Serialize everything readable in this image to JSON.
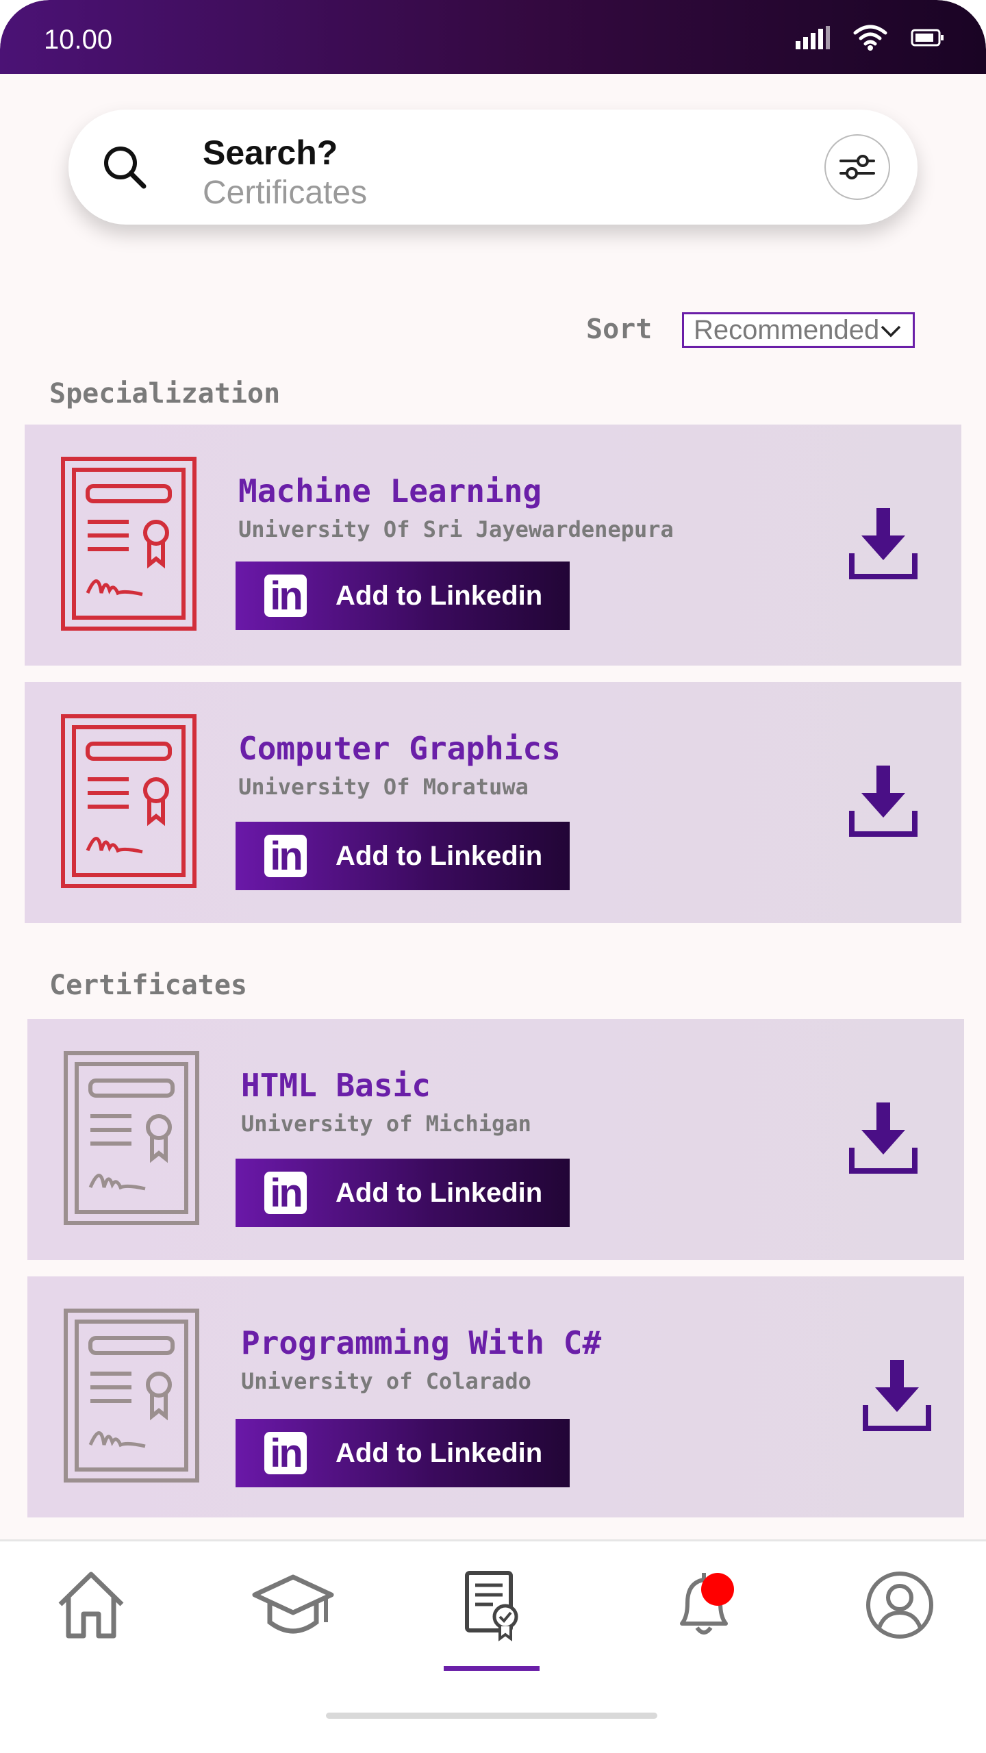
{
  "status_bar": {
    "time": "10.00"
  },
  "search": {
    "title": "Search?",
    "subtitle": "Certificates"
  },
  "sort": {
    "label": "Sort",
    "selected": "Recommended"
  },
  "sections": [
    {
      "label": "Specialization",
      "cards": [
        {
          "title": "Machine Learning",
          "university": "University Of Sri Jayewardenepura",
          "button": "Add to Linkedin"
        },
        {
          "title": "Computer Graphics",
          "university": "University Of Moratuwa",
          "button": "Add to Linkedin"
        }
      ]
    },
    {
      "label": "Certificates",
      "cards": [
        {
          "title": "HTML Basic",
          "university": "University of Michigan",
          "button": "Add to Linkedin"
        },
        {
          "title": "Programming With C#",
          "university": "University of Colarado",
          "button": "Add to Linkedin"
        }
      ]
    }
  ],
  "linkedin_logo_text": "in",
  "colors": {
    "accent": "#6a1fa8",
    "cert_specialization": "#d22e3a",
    "cert_certificate": "#9b8f8f",
    "notification_dot": "#ff0000"
  },
  "bottom_nav": [
    {
      "name": "home-icon",
      "active": false
    },
    {
      "name": "graduation-cap-icon",
      "active": false
    },
    {
      "name": "certificate-icon",
      "active": true
    },
    {
      "name": "bell-icon",
      "active": false,
      "badge": true
    },
    {
      "name": "profile-icon",
      "active": false
    }
  ]
}
